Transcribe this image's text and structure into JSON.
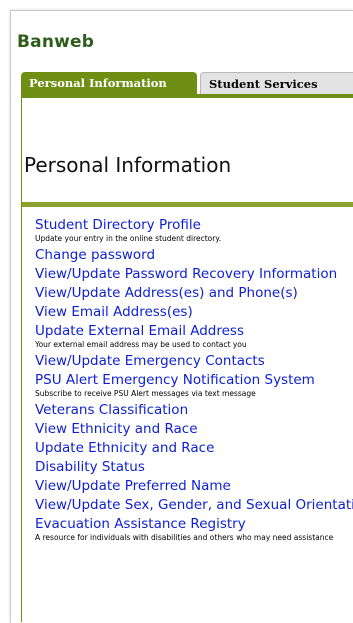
{
  "app": {
    "title": "Banweb"
  },
  "tabs": [
    {
      "label": "Personal Information"
    },
    {
      "label": "Student Services"
    }
  ],
  "page": {
    "title": "Personal Information"
  },
  "menu": [
    {
      "label": "Student Directory Profile",
      "desc": "Update your entry in the online student directory."
    },
    {
      "label": "Change password"
    },
    {
      "label": "View/Update Password Recovery Information"
    },
    {
      "label": "View/Update Address(es) and Phone(s)"
    },
    {
      "label": "View Email Address(es)"
    },
    {
      "label": "Update External Email Address",
      "desc": "Your external email address may be used to contact you"
    },
    {
      "label": "View/Update Emergency Contacts"
    },
    {
      "label": "PSU Alert Emergency Notification System",
      "desc": "Subscribe to receive PSU Alert messages via text message"
    },
    {
      "label": "Veterans Classification"
    },
    {
      "label": "View Ethnicity and Race"
    },
    {
      "label": "Update Ethnicity and Race"
    },
    {
      "label": "Disability Status"
    },
    {
      "label": "View/Update Preferred Name"
    },
    {
      "label": "View/Update Sex, Gender, and Sexual Orientation"
    },
    {
      "label": "Evacuation Assistance Registry",
      "desc": "A resource for individuals with disabilities and others who may need assistance"
    }
  ],
  "colors": {
    "brand": "#2e5d1b",
    "tab_active": "#6f8f14",
    "link": "#0d1fd1"
  }
}
